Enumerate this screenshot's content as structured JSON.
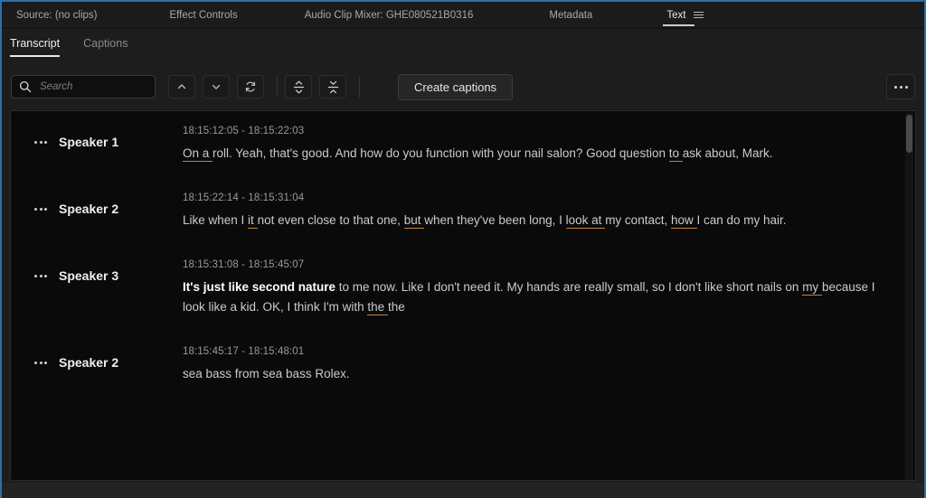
{
  "panel": {
    "accent_color": "#2d6ea8",
    "tabs": [
      {
        "label": "Source: (no clips)",
        "active": false
      },
      {
        "label": "Effect Controls",
        "active": false
      },
      {
        "label": "Audio Clip Mixer: GHE080521B0316",
        "active": false
      },
      {
        "label": "Metadata",
        "active": false
      },
      {
        "label": "Text",
        "active": true
      }
    ],
    "menu_icon": "hamburger-menu-icon"
  },
  "sub_tabs": [
    {
      "label": "Transcript",
      "active": true
    },
    {
      "label": "Captions",
      "active": false
    }
  ],
  "toolbar": {
    "search": {
      "placeholder": "Search",
      "value": "",
      "icon": "search-icon"
    },
    "prev_icon": "chevron-up-icon",
    "next_icon": "chevron-down-icon",
    "refresh_icon": "refresh-icon",
    "expand_icon": "expand-all-icon",
    "collapse_icon": "collapse-all-icon",
    "create_captions_label": "Create captions",
    "more_icon": "more-options-icon"
  },
  "transcript": {
    "underline_color": "#c1853f",
    "entries": [
      {
        "speaker": "Speaker 1",
        "timecode": "18:15:12:05 - 18:15:22:03",
        "segments": [
          {
            "text": "On a ",
            "underline": true,
            "highlight": false
          },
          {
            "text": "roll. Yeah, that's good. And how do you function with your nail salon? Good question ",
            "underline": false,
            "highlight": false
          },
          {
            "text": "to ",
            "underline": true,
            "highlight": false
          },
          {
            "text": "ask about, Mark.",
            "underline": false,
            "highlight": false
          }
        ]
      },
      {
        "speaker": "Speaker 2",
        "timecode": "18:15:22:14 - 18:15:31:04",
        "segments": [
          {
            "text": "Like when I ",
            "underline": false,
            "highlight": false
          },
          {
            "text": "it ",
            "underline": true,
            "highlight": false
          },
          {
            "text": "not even close to that one, ",
            "underline": false,
            "highlight": false
          },
          {
            "text": "but ",
            "underline": true,
            "highlight": false
          },
          {
            "text": "when they've been long, I ",
            "underline": false,
            "highlight": false
          },
          {
            "text": "look at ",
            "underline": true,
            "highlight": false
          },
          {
            "text": "my contact, ",
            "underline": false,
            "highlight": false
          },
          {
            "text": "how ",
            "underline": true,
            "highlight": false
          },
          {
            "text": "I can do my hair.",
            "underline": false,
            "highlight": false
          }
        ]
      },
      {
        "speaker": "Speaker 3",
        "timecode": "18:15:31:08 - 18:15:45:07",
        "segments": [
          {
            "text": "It's just like second nature",
            "underline": false,
            "highlight": true
          },
          {
            "text": " to me now. Like I don't need it. My hands are really small, so I don't like short nails on ",
            "underline": false,
            "highlight": false
          },
          {
            "text": "my ",
            "underline": true,
            "highlight": false
          },
          {
            "text": "because I look like a kid. OK, I think I'm with ",
            "underline": false,
            "highlight": false
          },
          {
            "text": "the ",
            "underline": true,
            "highlight": false
          },
          {
            "text": "the",
            "underline": false,
            "highlight": false
          }
        ]
      },
      {
        "speaker": "Speaker 2",
        "timecode": "18:15:45:17 - 18:15:48:01",
        "segments": [
          {
            "text": "sea bass from sea bass Rolex.",
            "underline": false,
            "highlight": false
          }
        ]
      }
    ]
  }
}
